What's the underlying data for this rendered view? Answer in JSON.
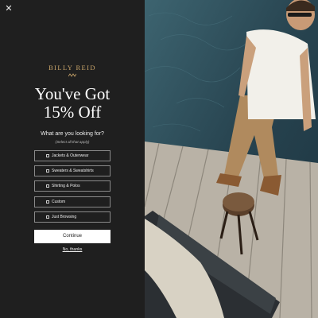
{
  "close": {
    "glyph": "✕"
  },
  "brand": {
    "name": "BILLY REID"
  },
  "headline": {
    "line1": "You've Got",
    "line2": "15% Off"
  },
  "question": {
    "text": "What are you looking for?",
    "hint": "(Select all that apply)"
  },
  "options": [
    {
      "label": "Jackets & Outerwear"
    },
    {
      "label": "Sweaters & Sweatshirts"
    },
    {
      "label": "Shirting & Polos"
    },
    {
      "label": "Custom"
    },
    {
      "label": "Just Browsing"
    }
  ],
  "cta": {
    "continue_label": "Continue",
    "decline_label": "No, thanks"
  },
  "colors": {
    "panel": "#1f1f1f",
    "accent_gold": "#c9a56a",
    "button_bg": "#ffffff",
    "water": "#2f4f5c",
    "dock": "#b7b0a4"
  },
  "icons": {
    "close": "close-icon",
    "brand_mark": "brand-emblem-icon",
    "checkbox": "checkbox-icon"
  }
}
